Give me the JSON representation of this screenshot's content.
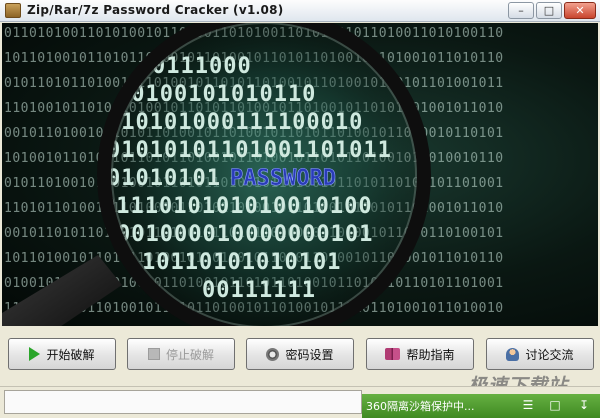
{
  "window": {
    "title": "Zip/Rar/7z Password Cracker (v1.08)",
    "minimize_glyph": "–",
    "maximize_glyph": "□",
    "close_glyph": "✕"
  },
  "hero": {
    "highlight_word": "PASSWORD",
    "binary_rows": [
      "0111000",
      "10100101010110",
      "010101000111100010",
      "01010101101001101011",
      "01010101",
      "0111010101010010100",
      "001000010000000101",
      "10110101010101",
      "00111111"
    ],
    "background_rows": [
      "011010100110101001011010011010100110101001011010011010100110",
      "101101001011010110100101101001011010110100101101001011010110",
      "010110101101001011010010110101101001011010010110101101001011",
      "110100101101011010010110101101001011010010110101101001011010",
      "001011010010110101101001011010010110101101001011010010110101",
      "101001011010010110101101001011010010110101101001011010010110",
      "010110100101101001011010110100101101001011010110100101101001",
      "110101101001011010010110101101001011010010110101101001011010",
      "001011010110100101101001011010110100101101001011010110100101",
      "101101001011010110100101101001011010110100101101001011010110",
      "010010110101101001011010010110101101001011010010110101101001",
      "110101001011010010110101101001011010010110101101001011010010"
    ],
    "colors": {
      "digits": "#cfe9df",
      "highlight": "#2a3cb8",
      "lens_rim": "#101010"
    }
  },
  "toolbar": {
    "start_label": "开始破解",
    "stop_label": "停止破解",
    "settings_label": "密码设置",
    "help_label": "帮助指南",
    "discuss_label": "讨论交流"
  },
  "statusbar": {
    "field_text": "",
    "green_notice": "360隔离沙箱保护中..."
  },
  "watermark": "极速下载站"
}
